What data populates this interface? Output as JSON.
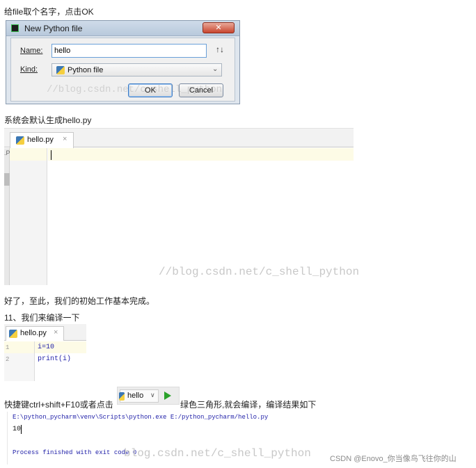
{
  "captions": {
    "c1": "给file取个名字，点击OK",
    "c2": "系统会默认生成hello.py",
    "c3": "好了，至此，我们的初始工作基本完成。",
    "c4": "11、我们来编译一下",
    "c5_before": "快捷键ctrl+shift+F10或者点击",
    "c5_after": "绿色三角形,就会编译，编译结果如下"
  },
  "dialog": {
    "title": "New Python file",
    "close_label": "✕",
    "name_label": "Name:",
    "name_value": "hello",
    "sort_label": "↑↓",
    "kind_label": "Kind:",
    "kind_value": "Python file",
    "ok_label": "OK",
    "cancel_label": "Cancel"
  },
  "editor1": {
    "tab_label": "hello.py",
    "tab_close": "×",
    "gutter_marker": ".P"
  },
  "editor2": {
    "tab_label": "hello.py",
    "tab_close": "×",
    "lines": [
      {
        "num": "1",
        "code": "i=10"
      },
      {
        "num": "2",
        "code": "print(i)"
      }
    ]
  },
  "run_widget": {
    "config_name": "hello",
    "dropdown": "∨"
  },
  "console": {
    "command": "E:\\python_pycharm\\venv\\Scripts\\python.exe E:/python_pycharm/hello.py",
    "output": "10",
    "exit_message": "Process finished with exit code 0"
  },
  "watermarks": {
    "w1": "//blog.csdn.net/c_shell_python",
    "w2": "//blog.csdn.net/c_shell_python",
    "w3": "blog.csdn.net/c_shell_python"
  },
  "credit": "CSDN @Enovo_你当像鸟飞往你的山",
  "colors": {
    "accent_green": "#2aa12a",
    "console_blue": "#1f1fa8",
    "editor_highlight": "#fdfbe6"
  }
}
